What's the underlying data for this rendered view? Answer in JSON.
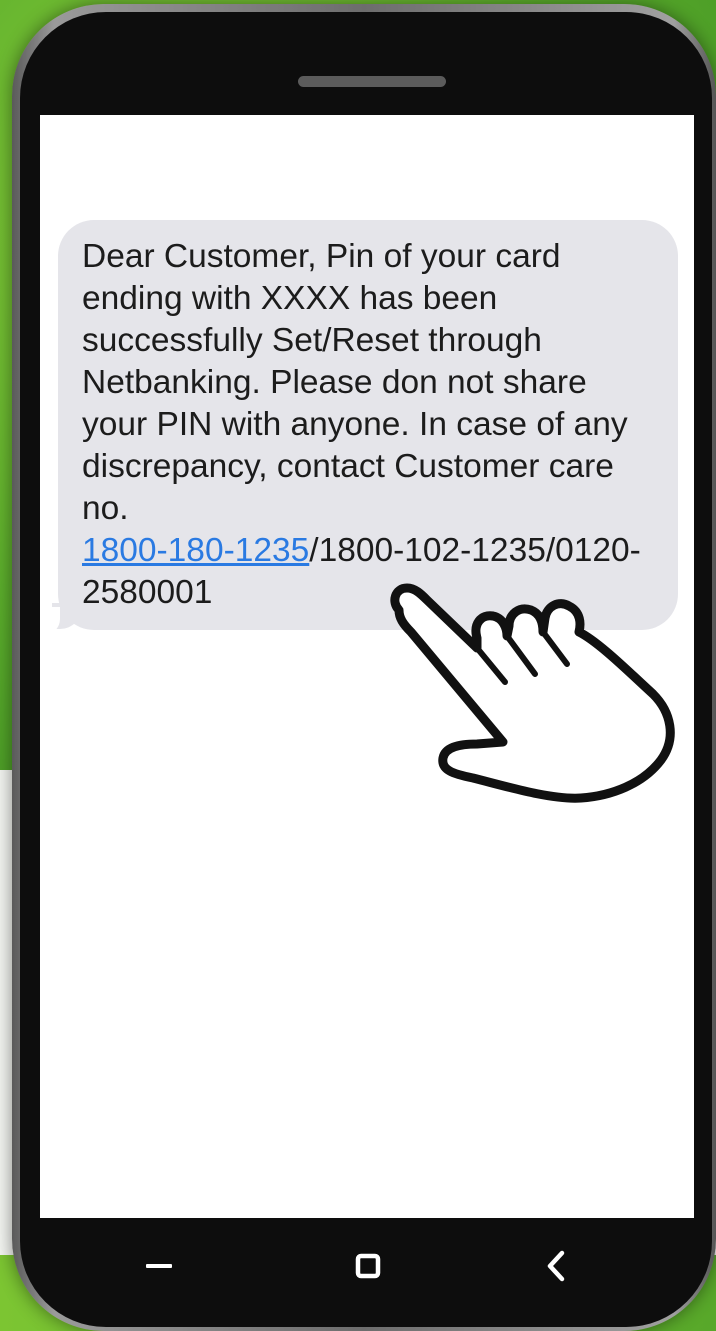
{
  "message": {
    "text": "Dear Customer, Pin of your card ending with XXXX has been successfully Set/Reset through Netbanking. Please don not share your PIN with anyone. In case of any discrepancy, contact Customer care no.",
    "phone_link": "1800-180-1235",
    "phone_rest": "/1800-102-1235/0120-2580001"
  },
  "colors": {
    "bubble": "#e5e5ea",
    "link": "#2a7ae2",
    "background_green": "#5cae2c"
  },
  "icons": {
    "pointer": "hand-pointer-icon",
    "recent": "recent-apps-icon",
    "home": "home-icon",
    "back": "back-icon"
  }
}
